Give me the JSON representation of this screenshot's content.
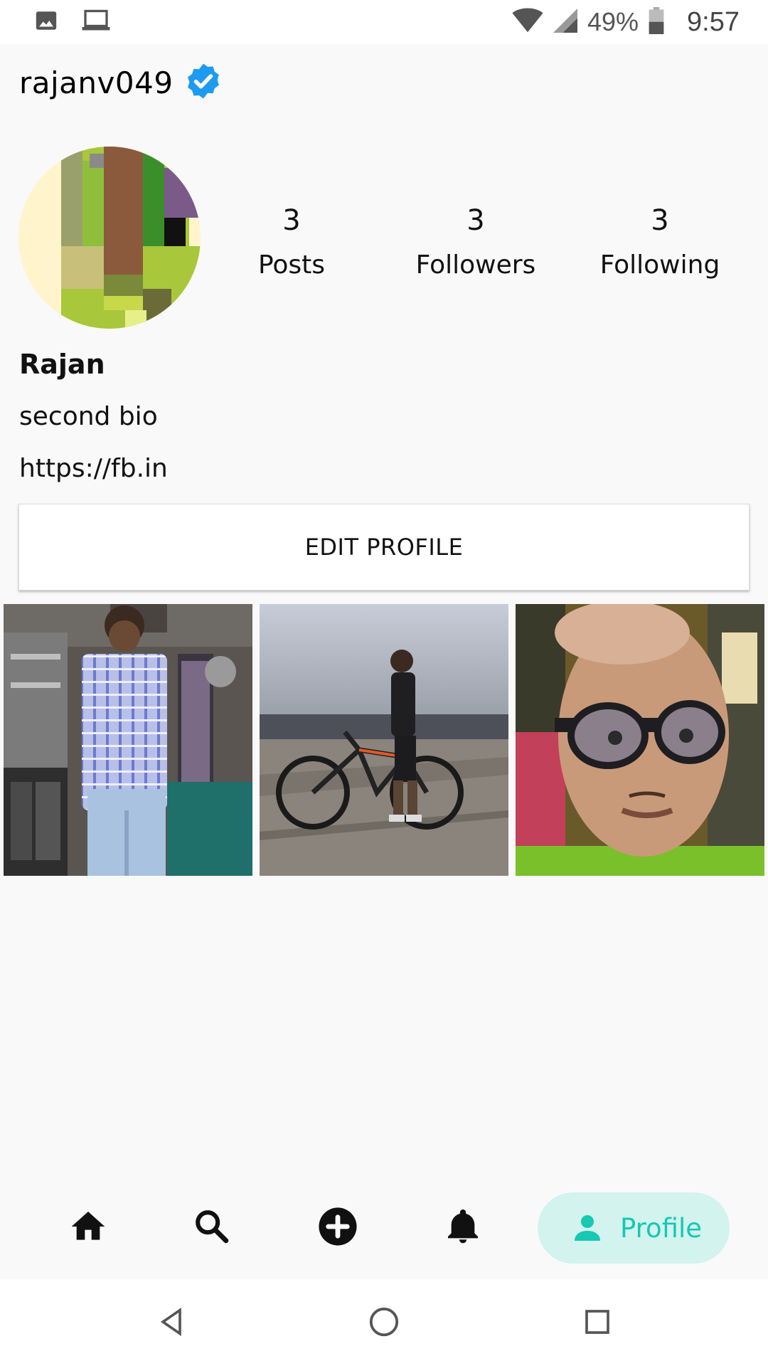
{
  "status_bar": {
    "battery": "49%",
    "time": "9:57",
    "icons": [
      "image-icon",
      "laptop-icon",
      "wifi-icon",
      "signal-icon",
      "battery-icon"
    ]
  },
  "header": {
    "username": "rajanv049",
    "verified_icon": "verified-badge-icon"
  },
  "profile": {
    "stats": [
      {
        "value": "3",
        "label": "Posts"
      },
      {
        "value": "3",
        "label": "Followers"
      },
      {
        "value": "3",
        "label": "Following"
      }
    ],
    "display_name": "Rajan",
    "bio": "second bio",
    "link": "https://fb.in",
    "edit_button": "EDIT PROFILE"
  },
  "posts": [
    {
      "name": "post-1"
    },
    {
      "name": "post-2"
    },
    {
      "name": "post-3"
    }
  ],
  "bottom_nav": {
    "items": [
      "home-icon",
      "search-icon",
      "add-icon",
      "notifications-icon"
    ],
    "active_label": "Profile",
    "active_icon": "person-icon",
    "accent": "#17c8b3",
    "accent_bg": "#d2f3ee"
  },
  "system_nav": [
    "back-icon",
    "home-circle-icon",
    "recents-icon"
  ]
}
